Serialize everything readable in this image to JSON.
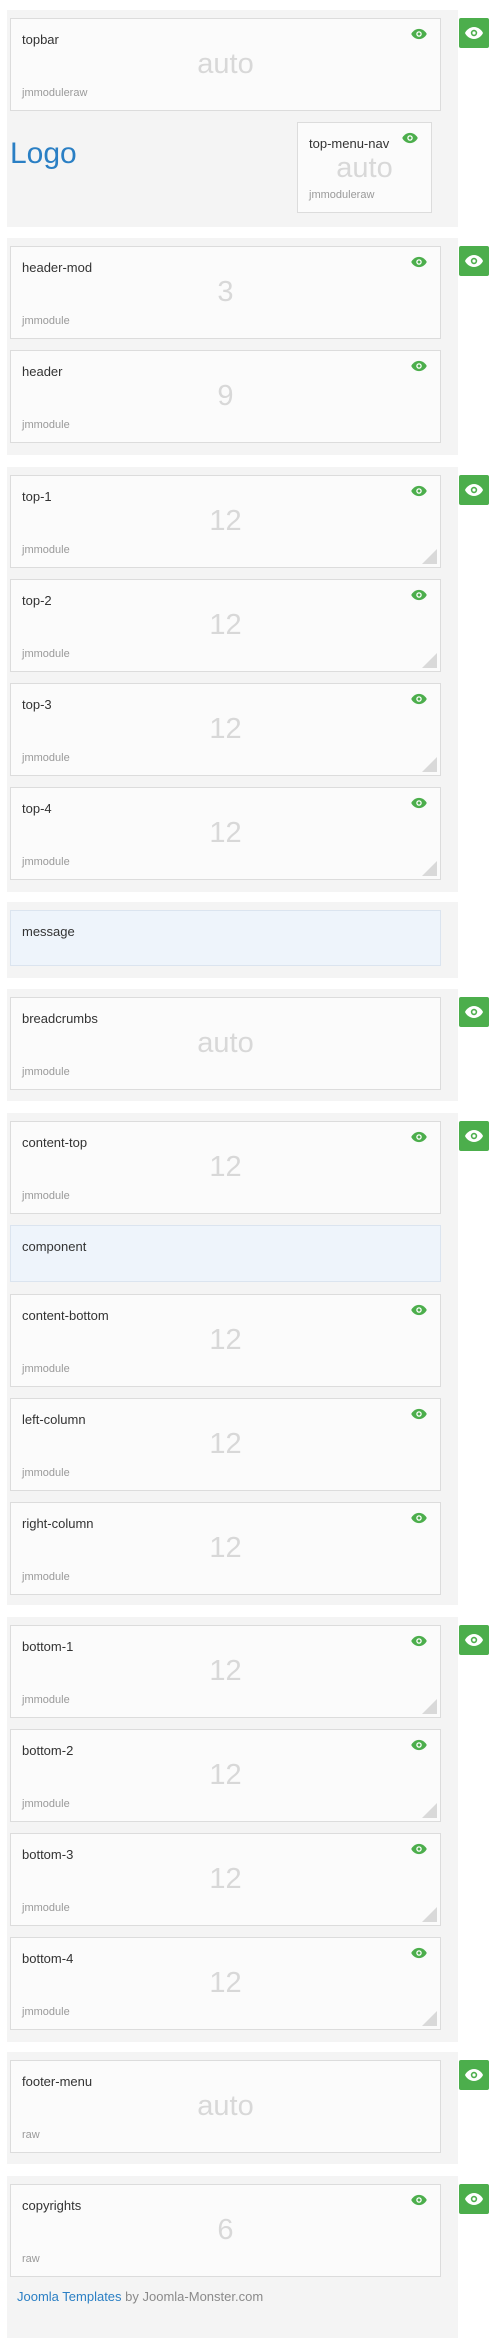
{
  "topbar_section": {
    "topbar": {
      "name": "topbar",
      "size": "auto",
      "type": "jmmoduleraw"
    },
    "logo": "Logo",
    "top_menu_nav": {
      "name": "top-menu-nav",
      "size": "auto",
      "type": "jmmoduleraw"
    }
  },
  "header_section": {
    "modules": [
      {
        "name": "header-mod",
        "size": "3",
        "type": "jmmodule"
      },
      {
        "name": "header",
        "size": "9",
        "type": "jmmodule"
      }
    ]
  },
  "top_section": {
    "modules": [
      {
        "name": "top-1",
        "size": "12",
        "type": "jmmodule"
      },
      {
        "name": "top-2",
        "size": "12",
        "type": "jmmodule"
      },
      {
        "name": "top-3",
        "size": "12",
        "type": "jmmodule"
      },
      {
        "name": "top-4",
        "size": "12",
        "type": "jmmodule"
      }
    ]
  },
  "message_section": {
    "label": "message"
  },
  "breadcrumbs_section": {
    "name": "breadcrumbs",
    "size": "auto",
    "type": "jmmodule"
  },
  "content_section": {
    "content_top": {
      "name": "content-top",
      "size": "12",
      "type": "jmmodule"
    },
    "component": "component",
    "modules": [
      {
        "name": "content-bottom",
        "size": "12",
        "type": "jmmodule"
      },
      {
        "name": "left-column",
        "size": "12",
        "type": "jmmodule"
      },
      {
        "name": "right-column",
        "size": "12",
        "type": "jmmodule"
      }
    ]
  },
  "bottom_section": {
    "modules": [
      {
        "name": "bottom-1",
        "size": "12",
        "type": "jmmodule"
      },
      {
        "name": "bottom-2",
        "size": "12",
        "type": "jmmodule"
      },
      {
        "name": "bottom-3",
        "size": "12",
        "type": "jmmodule"
      },
      {
        "name": "bottom-4",
        "size": "12",
        "type": "jmmodule"
      }
    ]
  },
  "footer_menu_section": {
    "name": "footer-menu",
    "size": "auto",
    "type": "raw"
  },
  "copyrights_section": {
    "name": "copyrights",
    "size": "6",
    "type": "raw"
  },
  "footer": {
    "link_text": "Joomla Templates",
    "by_text": " by Joomla-Monster.com"
  },
  "colors": {
    "visible_green": "#4cae4c",
    "logo_blue": "#2a7fc4",
    "message_bg": "#eef4fb"
  },
  "icons": {
    "visibility_toggle": "eye-icon",
    "card_visibility": "eye-icon",
    "resize": "resize-handle-icon"
  }
}
